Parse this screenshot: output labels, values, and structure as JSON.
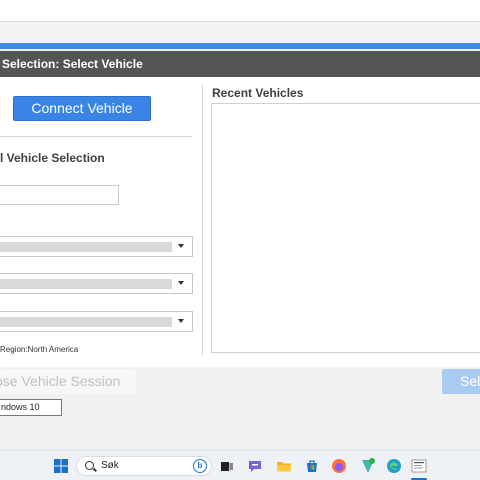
{
  "window": {
    "title": "Selection: Select Vehicle",
    "title_shown": "e Selection: Select Vehicle"
  },
  "left_panel": {
    "connect_button": "Connect Vehicle",
    "manual_section_title": "l Vehicle Selection",
    "vin_input_value": "",
    "region_text": "Region:North America"
  },
  "right_panel": {
    "recent_title": "Recent Vehicles"
  },
  "footer": {
    "close_session_button": "ose Vehicle Session",
    "select_button": "Sel"
  },
  "tooltip": {
    "text": "ndows 10"
  },
  "taskbar": {
    "search_label": "Søk",
    "search_bing_glyph": "b",
    "icons": [
      "windows-start-icon",
      "search-icon",
      "task-view-icon",
      "teams-chat-icon",
      "file-explorer-icon",
      "microsoft-store-icon",
      "firefox-icon",
      "vpn-shield-icon",
      "edge-icon",
      "app-window-icon"
    ]
  },
  "colors": {
    "accent": "#3a84e6",
    "titlebar": "#555555",
    "select_disabled": "#a9cbf2"
  }
}
